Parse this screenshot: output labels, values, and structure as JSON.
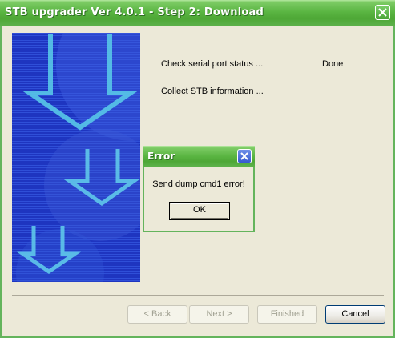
{
  "window": {
    "title": "STB upgrader Ver 4.0.1 - Step 2: Download"
  },
  "status": [
    {
      "label": "Check serial port status ...",
      "value": "Done"
    },
    {
      "label": "Collect STB information ...",
      "value": ""
    }
  ],
  "buttons": {
    "back": "< Back",
    "next": "Next >",
    "finished": "Finished",
    "cancel": "Cancel"
  },
  "dialog": {
    "title": "Error",
    "message": "Send dump cmd1 error!",
    "ok": "OK"
  },
  "colors": {
    "titlebar": "#5ab542",
    "banner": "#1a2fb0",
    "dialog_close": "#3559d0"
  },
  "icons": {
    "close": "close-icon",
    "arrows": "down-arrow-icon"
  }
}
